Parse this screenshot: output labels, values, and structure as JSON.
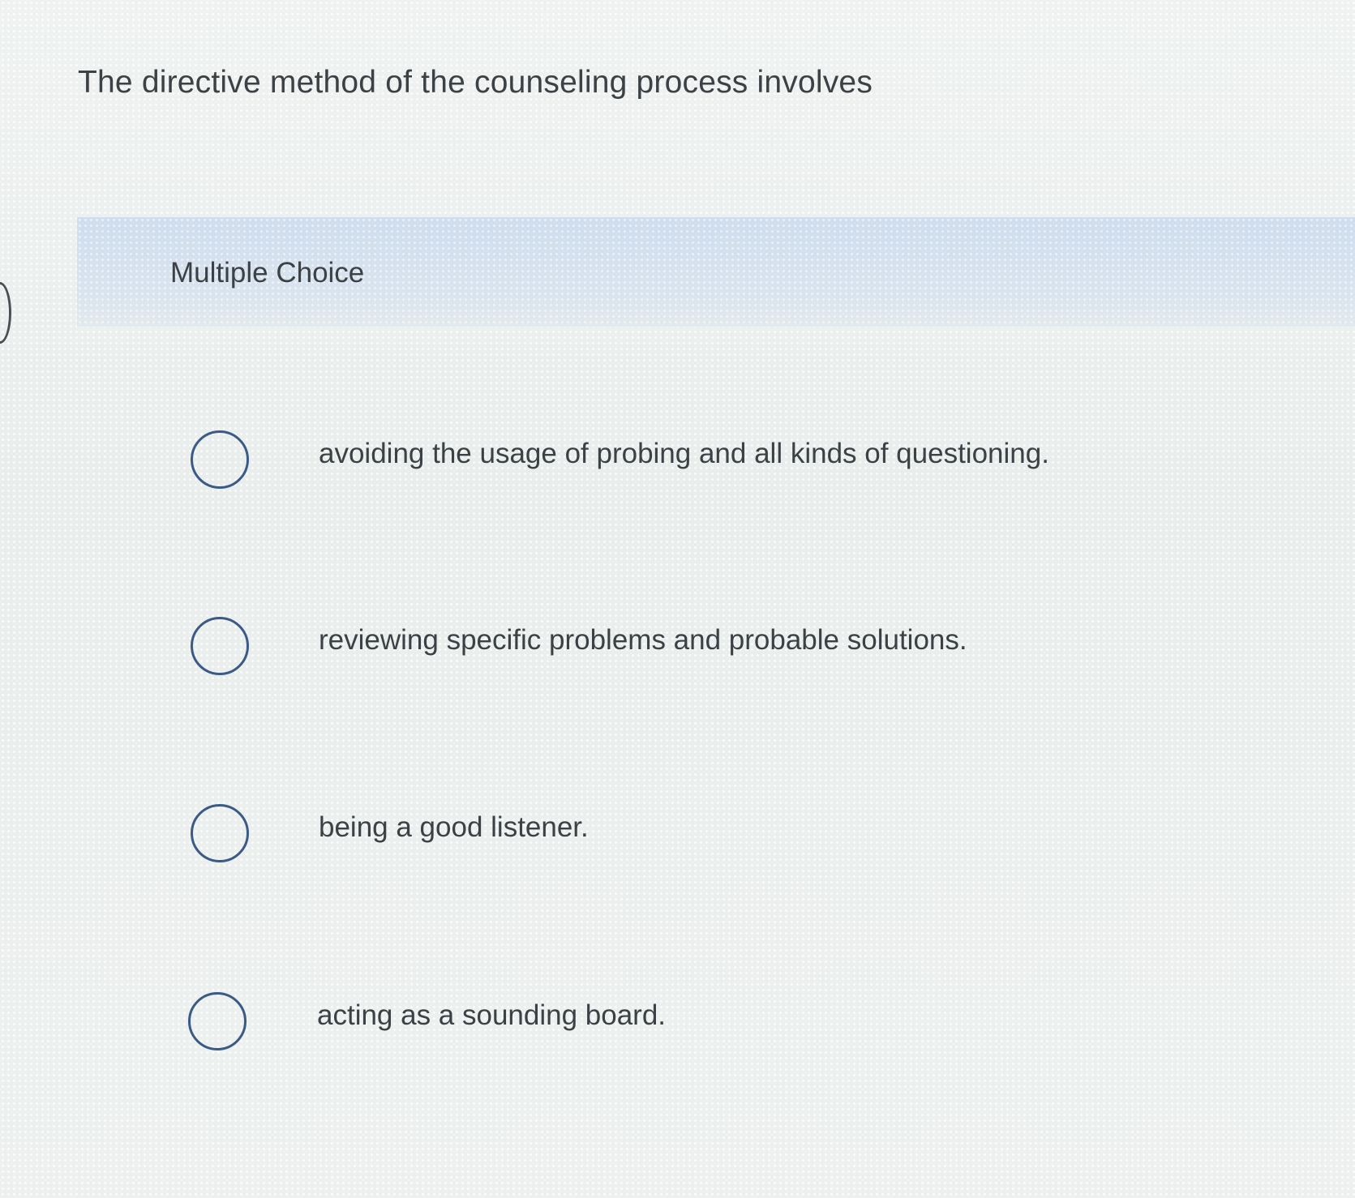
{
  "question": {
    "text": "The directive method of the counseling process involves"
  },
  "multiple_choice": {
    "label": "Multiple Choice",
    "options": [
      {
        "text": "avoiding the usage of probing and all kinds of questioning.",
        "selected": false
      },
      {
        "text": "reviewing specific problems and probable solutions.",
        "selected": false
      },
      {
        "text": "being a good listener.",
        "selected": false
      },
      {
        "text": "acting as a sounding board.",
        "selected": false
      }
    ]
  },
  "colors": {
    "text": "#3c4146",
    "header_band": "#d6e3f1",
    "radio_border": "#3c5a86",
    "background": "#eef2f0"
  }
}
